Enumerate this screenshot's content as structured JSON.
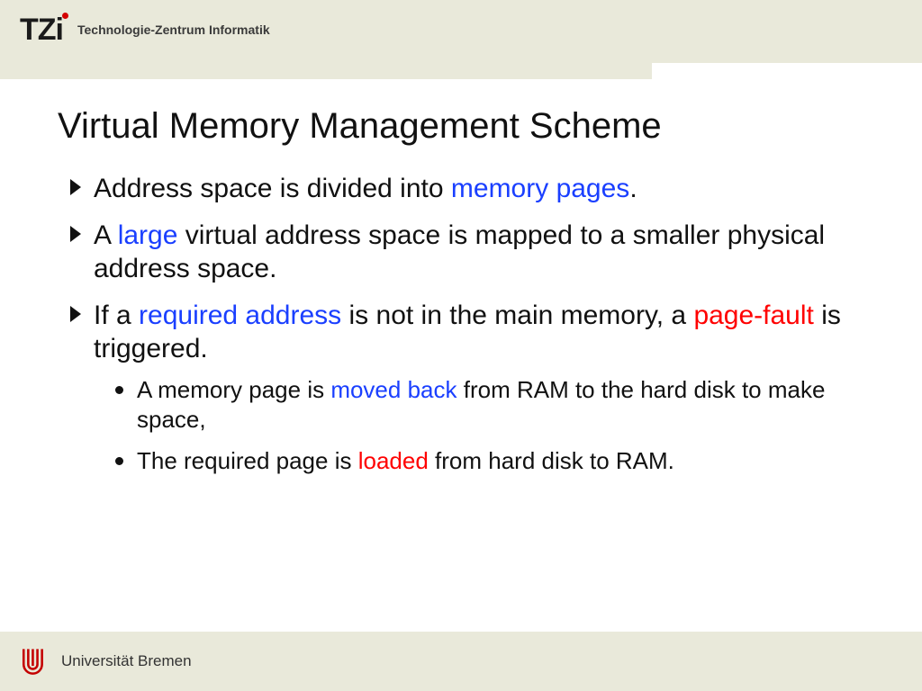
{
  "header": {
    "logo_text": "TZi",
    "org_text": "Technologie-Zentrum Informatik"
  },
  "slide": {
    "title": "Virtual Memory Management Scheme",
    "bullets": [
      {
        "segments": [
          {
            "t": "Address space is divided into ",
            "c": ""
          },
          {
            "t": "memory pages",
            "c": "blue"
          },
          {
            "t": ".",
            "c": ""
          }
        ]
      },
      {
        "segments": [
          {
            "t": "A ",
            "c": ""
          },
          {
            "t": "large",
            "c": "blue"
          },
          {
            "t": " virtual address space is mapped to a smaller physical address space.",
            "c": ""
          }
        ]
      },
      {
        "segments": [
          {
            "t": "If a ",
            "c": ""
          },
          {
            "t": "required address",
            "c": "blue"
          },
          {
            "t": " is not in the main memory, a ",
            "c": ""
          },
          {
            "t": "page-fault",
            "c": "red"
          },
          {
            "t": " is triggered.",
            "c": ""
          }
        ],
        "sub": [
          {
            "segments": [
              {
                "t": "A memory page is ",
                "c": ""
              },
              {
                "t": "moved back",
                "c": "blue"
              },
              {
                "t": " from RAM to the hard disk to make space,",
                "c": ""
              }
            ]
          },
          {
            "segments": [
              {
                "t": "The required page is ",
                "c": ""
              },
              {
                "t": "loaded",
                "c": "red"
              },
              {
                "t": " from hard disk to RAM.",
                "c": ""
              }
            ]
          }
        ]
      }
    ]
  },
  "footer": {
    "university": "Universität Bremen"
  }
}
